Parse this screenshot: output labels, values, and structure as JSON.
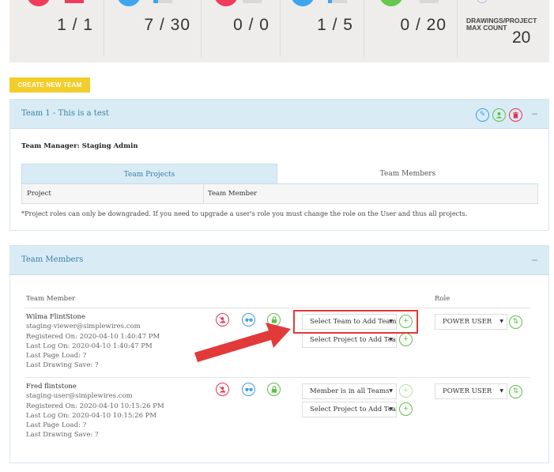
{
  "stats": [
    {
      "value": "1 / 1",
      "color": "#ef3b5c",
      "fill": 1.0
    },
    {
      "value": "7 / 30",
      "color": "#3fa6ee",
      "fill": 0.23
    },
    {
      "value": "0 / 0",
      "color": "#ef3b5c",
      "fill": 0.0
    },
    {
      "value": "1 / 5",
      "color": "#3fa6ee",
      "fill": 0.2
    },
    {
      "value": "0 / 20",
      "color": "#65c84c",
      "fill": 0.0
    }
  ],
  "drawings_stat": {
    "label": "DRAWINGS/PROJECT MAX COUNT",
    "value": "20"
  },
  "create_team_label": "CREATE NEW TEAM",
  "team_panel": {
    "title": "Team 1 - This is a test",
    "icons": [
      "pencil-icon",
      "user-icon",
      "trash-icon"
    ],
    "collapse_label": "–",
    "manager_label": "Team Manager: Staging Admin",
    "tabs": [
      "Team Projects",
      "Team Members"
    ],
    "table_headers": [
      "Project",
      "Team Member"
    ],
    "note": "*Project roles can only be downgraded. If you need to upgrade a user's role you must change the role on the User and thus all projects."
  },
  "members_panel": {
    "title": "Team Members",
    "collapse_label": "–",
    "headers": {
      "member": "Team Member",
      "role": "Role"
    },
    "members": [
      {
        "name": "Wilma FlintStone",
        "email": "staging-viewer@simplewires.com",
        "registered": "Registered On: 2020-04-10 1:40:47 PM",
        "last_logon": "Last Log On: 2020-04-10 1:40:47 PM",
        "last_page_load": "Last Page Load: ?",
        "last_drawing_save": "Last Drawing Save: ?",
        "team_select": "Select Team to Add Team",
        "project_select": "Select Project to Add Team",
        "role": "POWER USER"
      },
      {
        "name": "Fred flintstone",
        "email": "staging-user@simplewires.com",
        "registered": "Registered On: 2020-04-10 10:15:26 PM",
        "last_logon": "Last Log On: 2020-04-10 10:15:26 PM",
        "last_page_load": "Last Page Load: ?",
        "last_drawing_save": "Last Drawing Save: ?",
        "team_select": "Member is in all Teams",
        "project_select": "Select Project to Add Team",
        "role": "POWER USER"
      }
    ]
  },
  "annotation": {
    "highlight_color": "#e23a3a",
    "arrow_color": "#e23a3a"
  }
}
